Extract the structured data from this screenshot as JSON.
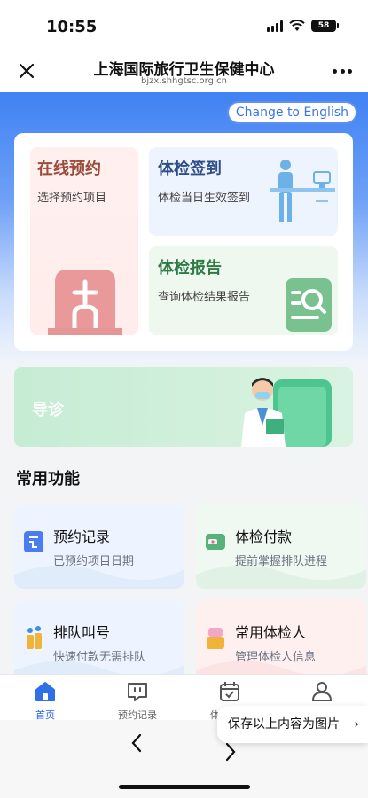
{
  "status_bar": {
    "time": "10:55",
    "battery": "58"
  },
  "nav": {
    "title": "上海国际旅行卫生保健中心",
    "subtitle": "bjzx.shhgtsc.org.cn"
  },
  "lang_button": "Change to English",
  "features": {
    "online": {
      "title": "在线预约",
      "desc": "选择预约项目"
    },
    "checkin": {
      "title": "体检签到",
      "desc": "体检当日生效签到"
    },
    "report": {
      "title": "体检报告",
      "desc": "查询体检结果报告"
    }
  },
  "guide": {
    "label": "导诊"
  },
  "section_title": "常用功能",
  "functions": [
    {
      "title": "预约记录",
      "desc": "已预约项目日期"
    },
    {
      "title": "体检付款",
      "desc": "提前掌握排队进程"
    },
    {
      "title": "排队叫号",
      "desc": "快速付款无需排队"
    },
    {
      "title": "常用体检人",
      "desc": "管理体检人信息"
    }
  ],
  "tabs": [
    {
      "label": "首页",
      "icon": "home-icon"
    },
    {
      "label": "预约记录",
      "icon": "chat-icon"
    },
    {
      "label": "体检报告",
      "icon": "calendar-check-icon"
    },
    {
      "label": "我的",
      "icon": "user-icon"
    }
  ],
  "save_toast": {
    "label": "保存以上内容为图片"
  },
  "colors": {
    "primary": "#3f82f3",
    "tab_active": "#2563eb"
  }
}
